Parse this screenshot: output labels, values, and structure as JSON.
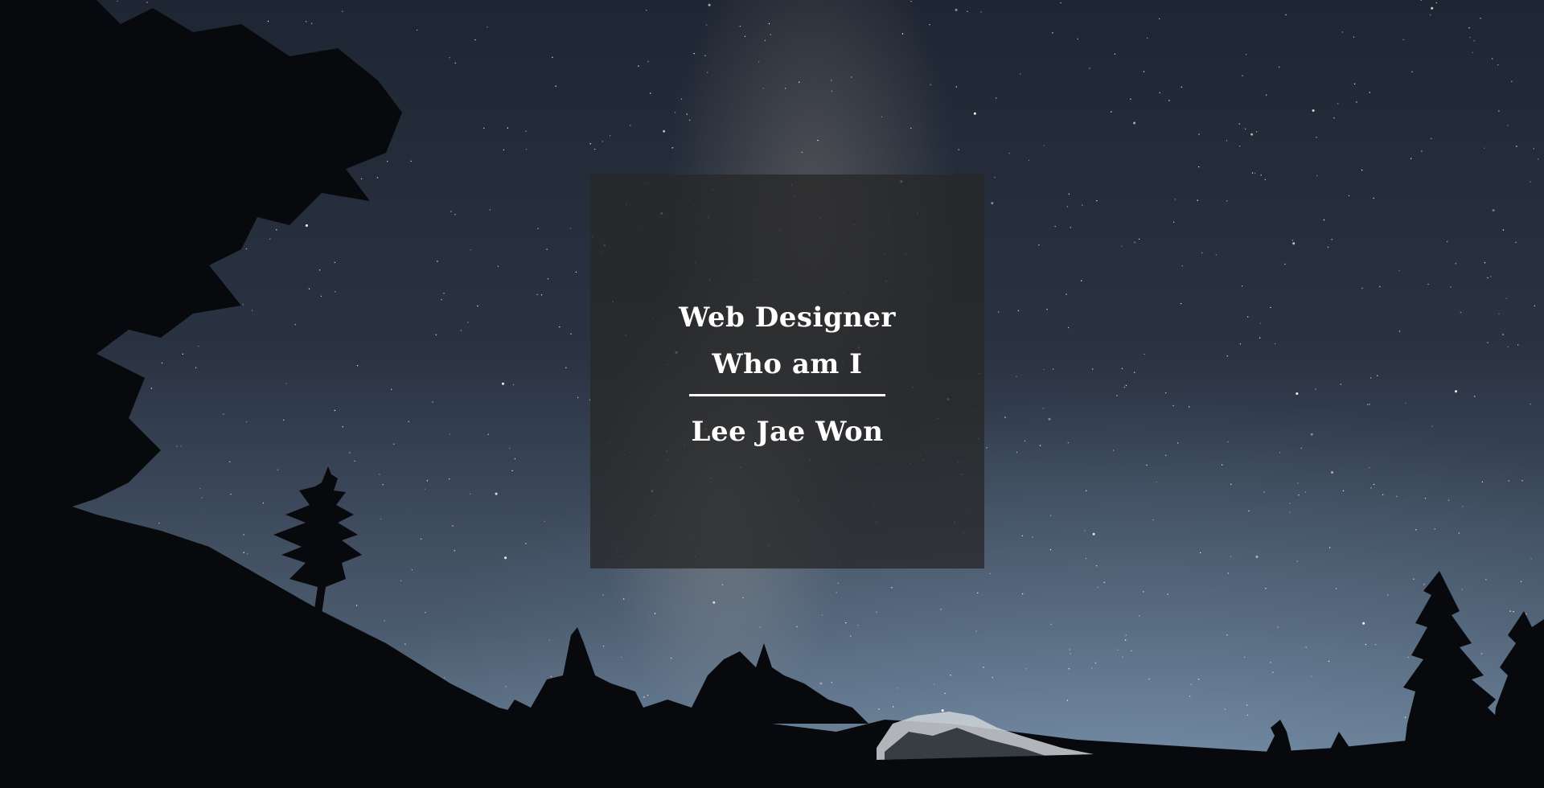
{
  "hero": {
    "title_line1": "Web Designer",
    "title_line2": "Who am I",
    "name": "Lee Jae Won"
  },
  "colors": {
    "card_overlay": "#282828",
    "text": "#ffffff",
    "sky_top": "#1f2633",
    "sky_horizon": "#6a7f94",
    "silhouette": "#07090c"
  }
}
